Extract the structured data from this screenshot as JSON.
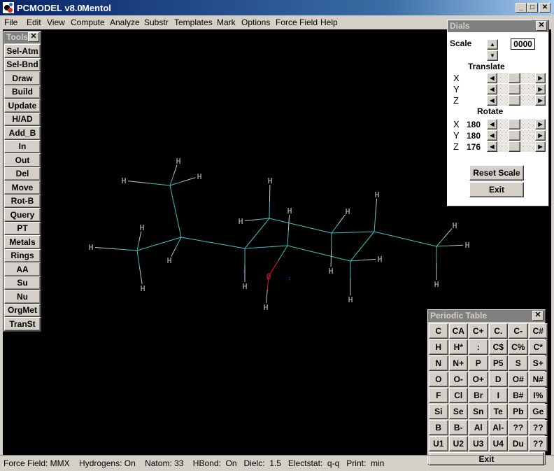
{
  "window": {
    "app_title": "PCMODEL v8.0",
    "document": "Mentol",
    "minimize": "_",
    "maximize": "□",
    "close": "✕"
  },
  "menu": [
    "File",
    "Edit",
    "View",
    "Compute",
    "Analyze",
    "Substr",
    "Templates",
    "Mark",
    "Options",
    "Force Field",
    "Help"
  ],
  "tools": {
    "title": "Tools",
    "close": "✕",
    "buttons": [
      "Sel-Atm",
      "Sel-Bnd",
      "Draw",
      "Build",
      "Update",
      "H/AD",
      "Add_B",
      "In",
      "Out",
      "Del",
      "Move",
      "Rot-B",
      "Query",
      "PT",
      "Metals",
      "Rings",
      "AA",
      "Su",
      "Nu",
      "OrgMet",
      "TranSt"
    ]
  },
  "dials": {
    "title": "Dials",
    "close": "✕",
    "scale_label": "Scale",
    "scale_value": "0000",
    "translate_label": "Translate",
    "rotate_label": "Rotate",
    "translate": [
      {
        "axis": "X",
        "value": ""
      },
      {
        "axis": "Y",
        "value": ""
      },
      {
        "axis": "Z",
        "value": ""
      }
    ],
    "rotate": [
      {
        "axis": "X",
        "value": "180"
      },
      {
        "axis": "Y",
        "value": "180"
      },
      {
        "axis": "Z",
        "value": "176"
      }
    ],
    "reset_scale": "Reset Scale",
    "exit": "Exit"
  },
  "periodic_table": {
    "title": "Periodic Table",
    "close": "✕",
    "elements": [
      "C",
      "CA",
      "C+",
      "C.",
      "C-",
      "C#",
      "H",
      "H*",
      ":",
      "C$",
      "C%",
      "C*",
      "N",
      "N+",
      "P",
      "P5",
      "S",
      "S+",
      "O",
      "O-",
      "O+",
      "D",
      "O#",
      "N#",
      "F",
      "Cl",
      "Br",
      "I",
      "B#",
      "I%",
      "Si",
      "Se",
      "Sn",
      "Te",
      "Pb",
      "Ge",
      "B",
      "B-",
      "Al",
      "Al-",
      "??",
      "??",
      "U1",
      "U2",
      "U3",
      "U4",
      "Du",
      "??"
    ],
    "exit": "Exit"
  },
  "status": {
    "force_field": "Force Field: MMX",
    "hydrogens": "Hydrogens: On",
    "natom": "Natom: 33",
    "hbond": "HBond:  On",
    "dielc": "Dielc:  1.5",
    "electstat": "Electstat:  q-q",
    "print": "Print:  min"
  },
  "molecule": {
    "name": "Mentol",
    "colors": {
      "C": "#40c0c0",
      "H": "#c8c8c8",
      "O": "#e02020",
      "lone_pair": "#2020c0"
    },
    "heavy_atom_label": "O",
    "hydrogen_label": "H"
  }
}
